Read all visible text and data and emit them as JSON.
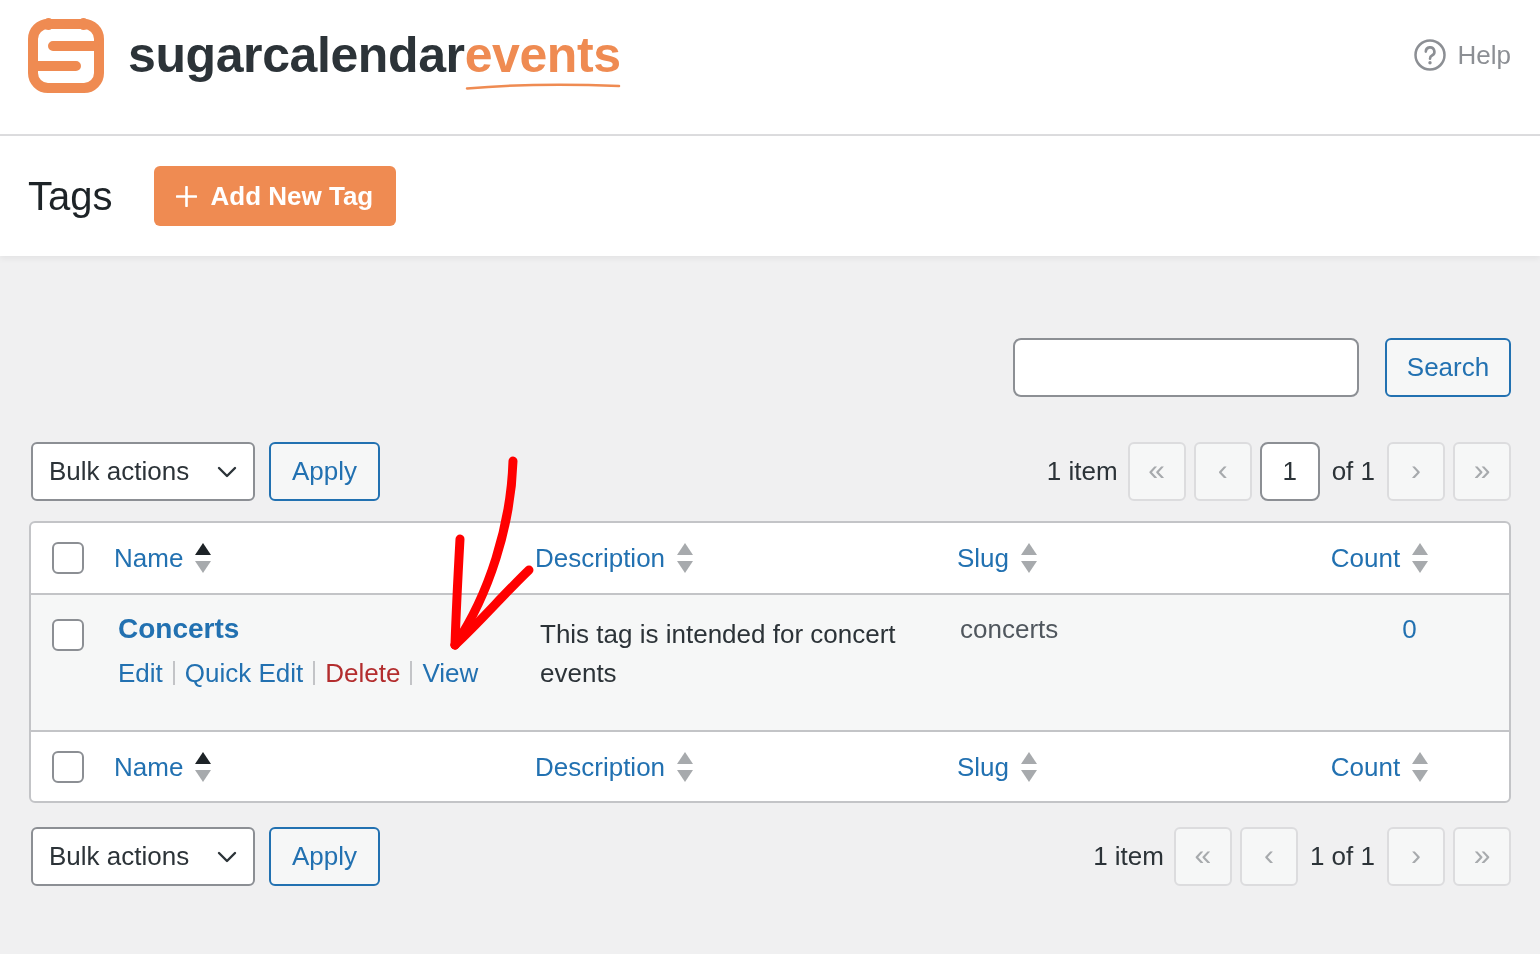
{
  "header": {
    "logo": {
      "name": "sugarcalendar",
      "accent": "events"
    },
    "help": {
      "label": "Help"
    }
  },
  "title_bar": {
    "title": "Tags",
    "add_button": "Add New Tag"
  },
  "search": {
    "button": "Search"
  },
  "top_nav": {
    "bulk_actions": "Bulk actions",
    "apply": "Apply",
    "item_count": "1 item",
    "pagination": [
      {
        "kind": "button",
        "label": "«",
        "disabled": true
      },
      {
        "kind": "button",
        "label": "‹",
        "disabled": true
      },
      {
        "kind": "input",
        "value": "1"
      },
      {
        "kind": "text",
        "label": "of 1"
      },
      {
        "kind": "button",
        "label": "›",
        "disabled": true
      },
      {
        "kind": "button",
        "label": "»",
        "disabled": true
      }
    ]
  },
  "table": {
    "select_all": {
      "checked": false
    },
    "columns": [
      {
        "label": "Name",
        "sorted": true
      },
      {
        "label": "Description",
        "sorted": false
      },
      {
        "label": "Slug",
        "sorted": false
      },
      {
        "label": "Count",
        "sorted": false
      }
    ],
    "rows": [
      {
        "checked": false,
        "name": "Concerts",
        "actions": [
          {
            "label": "Edit",
            "kind": "link"
          },
          {
            "label": "Quick Edit",
            "kind": "link"
          },
          {
            "label": "Delete",
            "kind": "delete"
          },
          {
            "label": "View",
            "kind": "link"
          }
        ],
        "description": "This tag is intended for concert events",
        "slug": "concerts",
        "count": "0"
      }
    ],
    "footer_select_all": {
      "checked": false
    },
    "footer_columns": [
      {
        "label": "Name",
        "sorted": true
      },
      {
        "label": "Description",
        "sorted": false
      },
      {
        "label": "Slug",
        "sorted": false
      },
      {
        "label": "Count",
        "sorted": false
      }
    ]
  },
  "bottom_nav": {
    "bulk_actions": "Bulk actions",
    "apply": "Apply",
    "item_count": "1 item",
    "pagination": [
      {
        "kind": "button",
        "label": "«",
        "disabled": true
      },
      {
        "kind": "button",
        "label": "‹",
        "disabled": true
      },
      {
        "kind": "text",
        "label": "1 of 1"
      },
      {
        "kind": "button",
        "label": "›",
        "disabled": true
      },
      {
        "kind": "button",
        "label": "»",
        "disabled": true
      }
    ]
  },
  "annotation": {
    "kind": "arrow"
  }
}
